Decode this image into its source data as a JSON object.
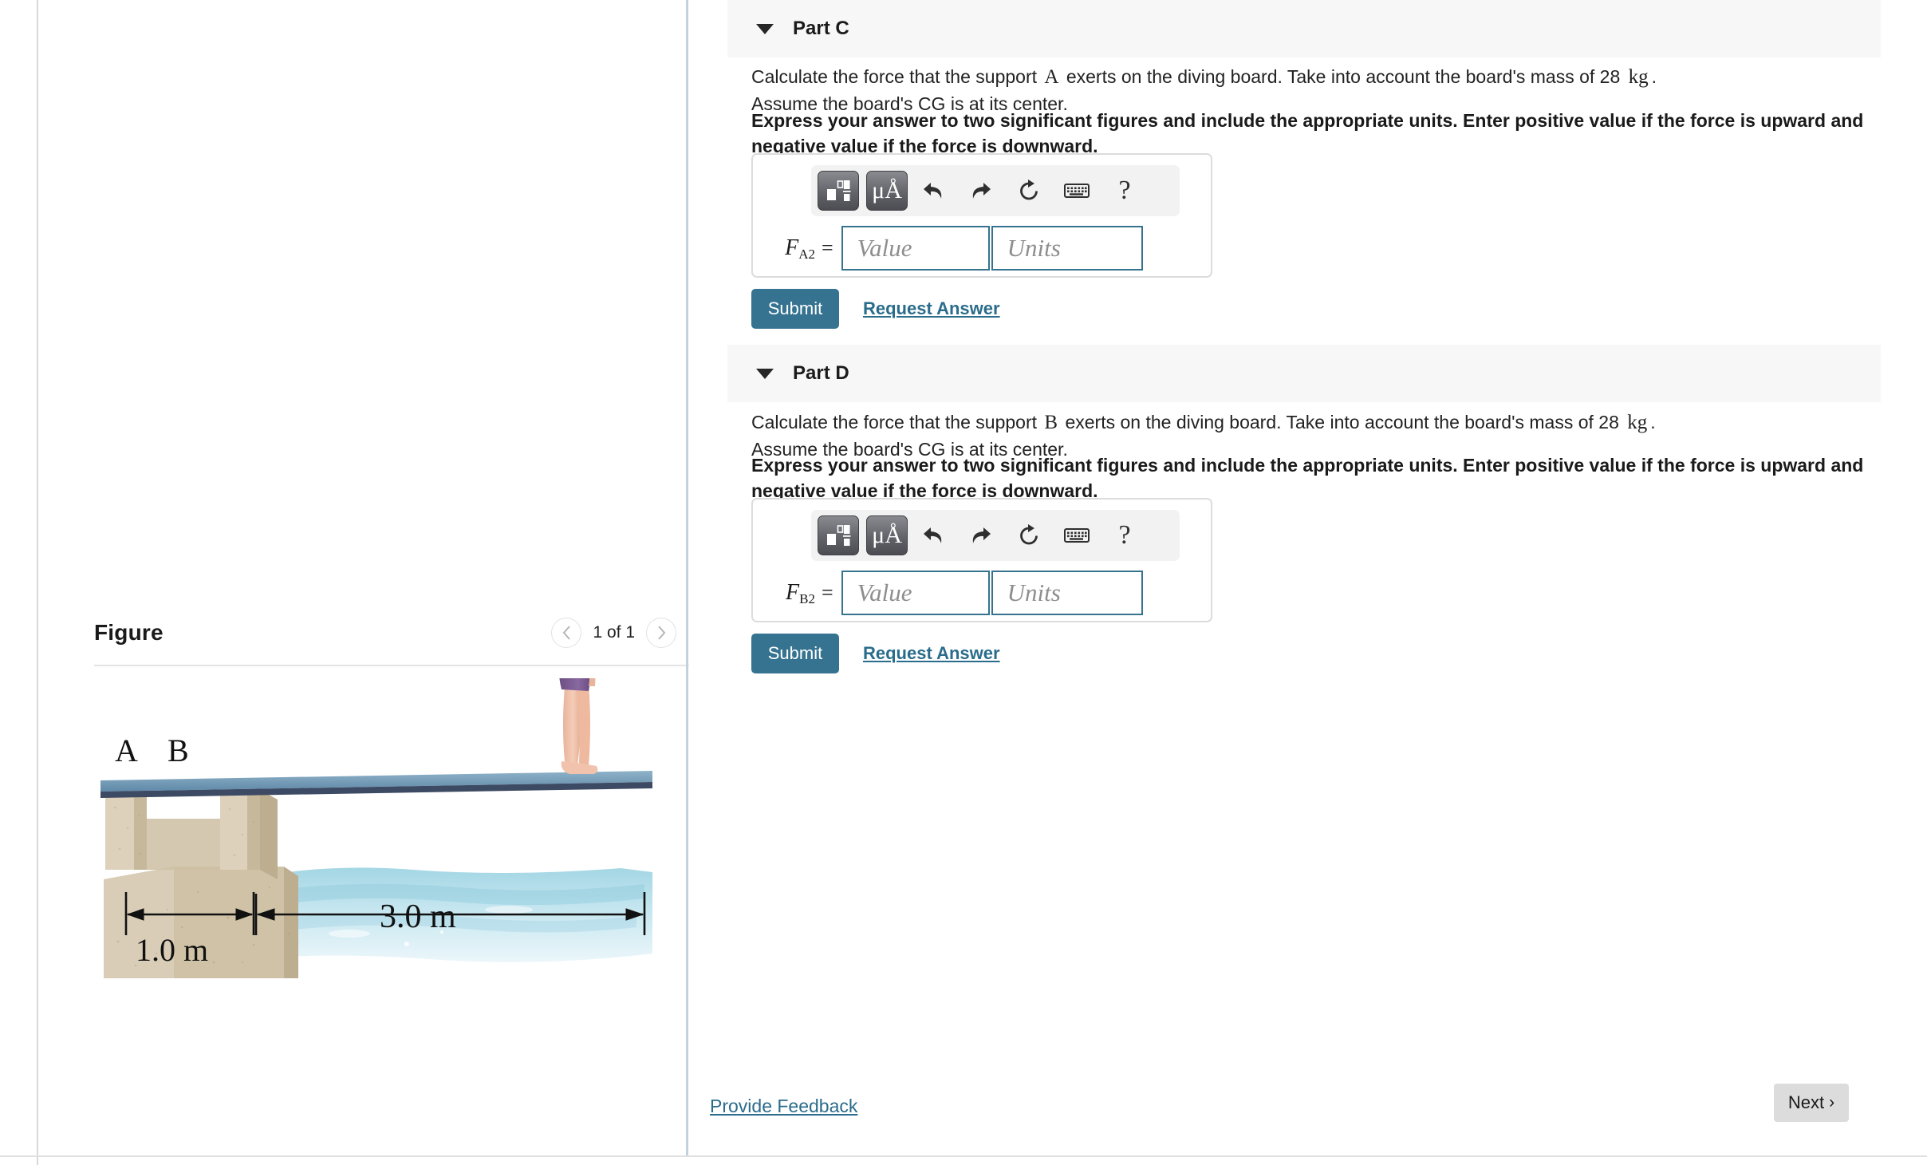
{
  "figure_panel": {
    "title": "Figure",
    "nav": {
      "prev_icon": "chevron-left-icon",
      "next_icon": "chevron-right-icon",
      "count_label": "1 of 1"
    },
    "illustration": {
      "description": "Diver standing on the end of a diving board supported at A and B on a concrete block beside a pool",
      "support_a_label": "A",
      "support_b_label": "B",
      "dim_support_span": "1.0 m",
      "dim_board_overhang": "3.0 m",
      "colors": {
        "board": "#6f96b4",
        "board_edge": "#3d4a63",
        "concrete": "#d9cdb7",
        "water": "#bfe2ec",
        "swimsuit": "#7b5a92",
        "skin": "#f0c3ae"
      }
    }
  },
  "parts": [
    {
      "id": "part-c",
      "header_label": "Part C",
      "caret_icon": "caret-down-icon",
      "question_prefix": "Calculate the force that the support",
      "question_var": "A",
      "question_mid": "exerts on the diving board. Take into account the board's mass of 28",
      "question_unit": "kg",
      "question_suffix": ".",
      "question_line2": "Assume the board's CG is at its center.",
      "instruction": "Express your answer to two significant figures and include the appropriate units. Enter positive value if the force is upward and negative value if the force is downward.",
      "answer": {
        "symbol": "F",
        "subscript": "A2",
        "equals": "=",
        "value_placeholder": "Value",
        "units_placeholder": "Units",
        "value_current": "",
        "units_current": ""
      },
      "toolbar": [
        {
          "name": "math-template-icon",
          "label": ""
        },
        {
          "name": "units-mu-angstrom-icon",
          "label": "μÅ"
        },
        {
          "name": "undo-icon",
          "label": ""
        },
        {
          "name": "redo-icon",
          "label": ""
        },
        {
          "name": "reset-icon",
          "label": ""
        },
        {
          "name": "keyboard-icon",
          "label": ""
        },
        {
          "name": "help-icon",
          "label": "?"
        }
      ],
      "submit_label": "Submit",
      "request_answer_label": "Request Answer"
    },
    {
      "id": "part-d",
      "header_label": "Part D",
      "caret_icon": "caret-down-icon",
      "question_prefix": "Calculate the force that the support",
      "question_var": "B",
      "question_mid": "exerts on the diving board. Take into account the board's mass of 28",
      "question_unit": "kg",
      "question_suffix": ".",
      "question_line2": "Assume the board's CG is at its center.",
      "instruction": "Express your answer to two significant figures and include the appropriate units. Enter positive value if the force is upward and negative value if the force is downward.",
      "answer": {
        "symbol": "F",
        "subscript": "B2",
        "equals": "=",
        "value_placeholder": "Value",
        "units_placeholder": "Units",
        "value_current": "",
        "units_current": ""
      },
      "toolbar": [
        {
          "name": "math-template-icon",
          "label": ""
        },
        {
          "name": "units-mu-angstrom-icon",
          "label": "μÅ"
        },
        {
          "name": "undo-icon",
          "label": ""
        },
        {
          "name": "redo-icon",
          "label": ""
        },
        {
          "name": "reset-icon",
          "label": ""
        },
        {
          "name": "keyboard-icon",
          "label": ""
        },
        {
          "name": "help-icon",
          "label": "?"
        }
      ],
      "submit_label": "Submit",
      "request_answer_label": "Request Answer"
    }
  ],
  "footer": {
    "provide_feedback_label": "Provide Feedback",
    "next_label": "Next",
    "next_chevron": "›"
  },
  "colors": {
    "accent_blue": "#357391",
    "link_blue": "#2a6c8b",
    "band_gray": "#f7f7f7",
    "field_border": "#35738f"
  }
}
